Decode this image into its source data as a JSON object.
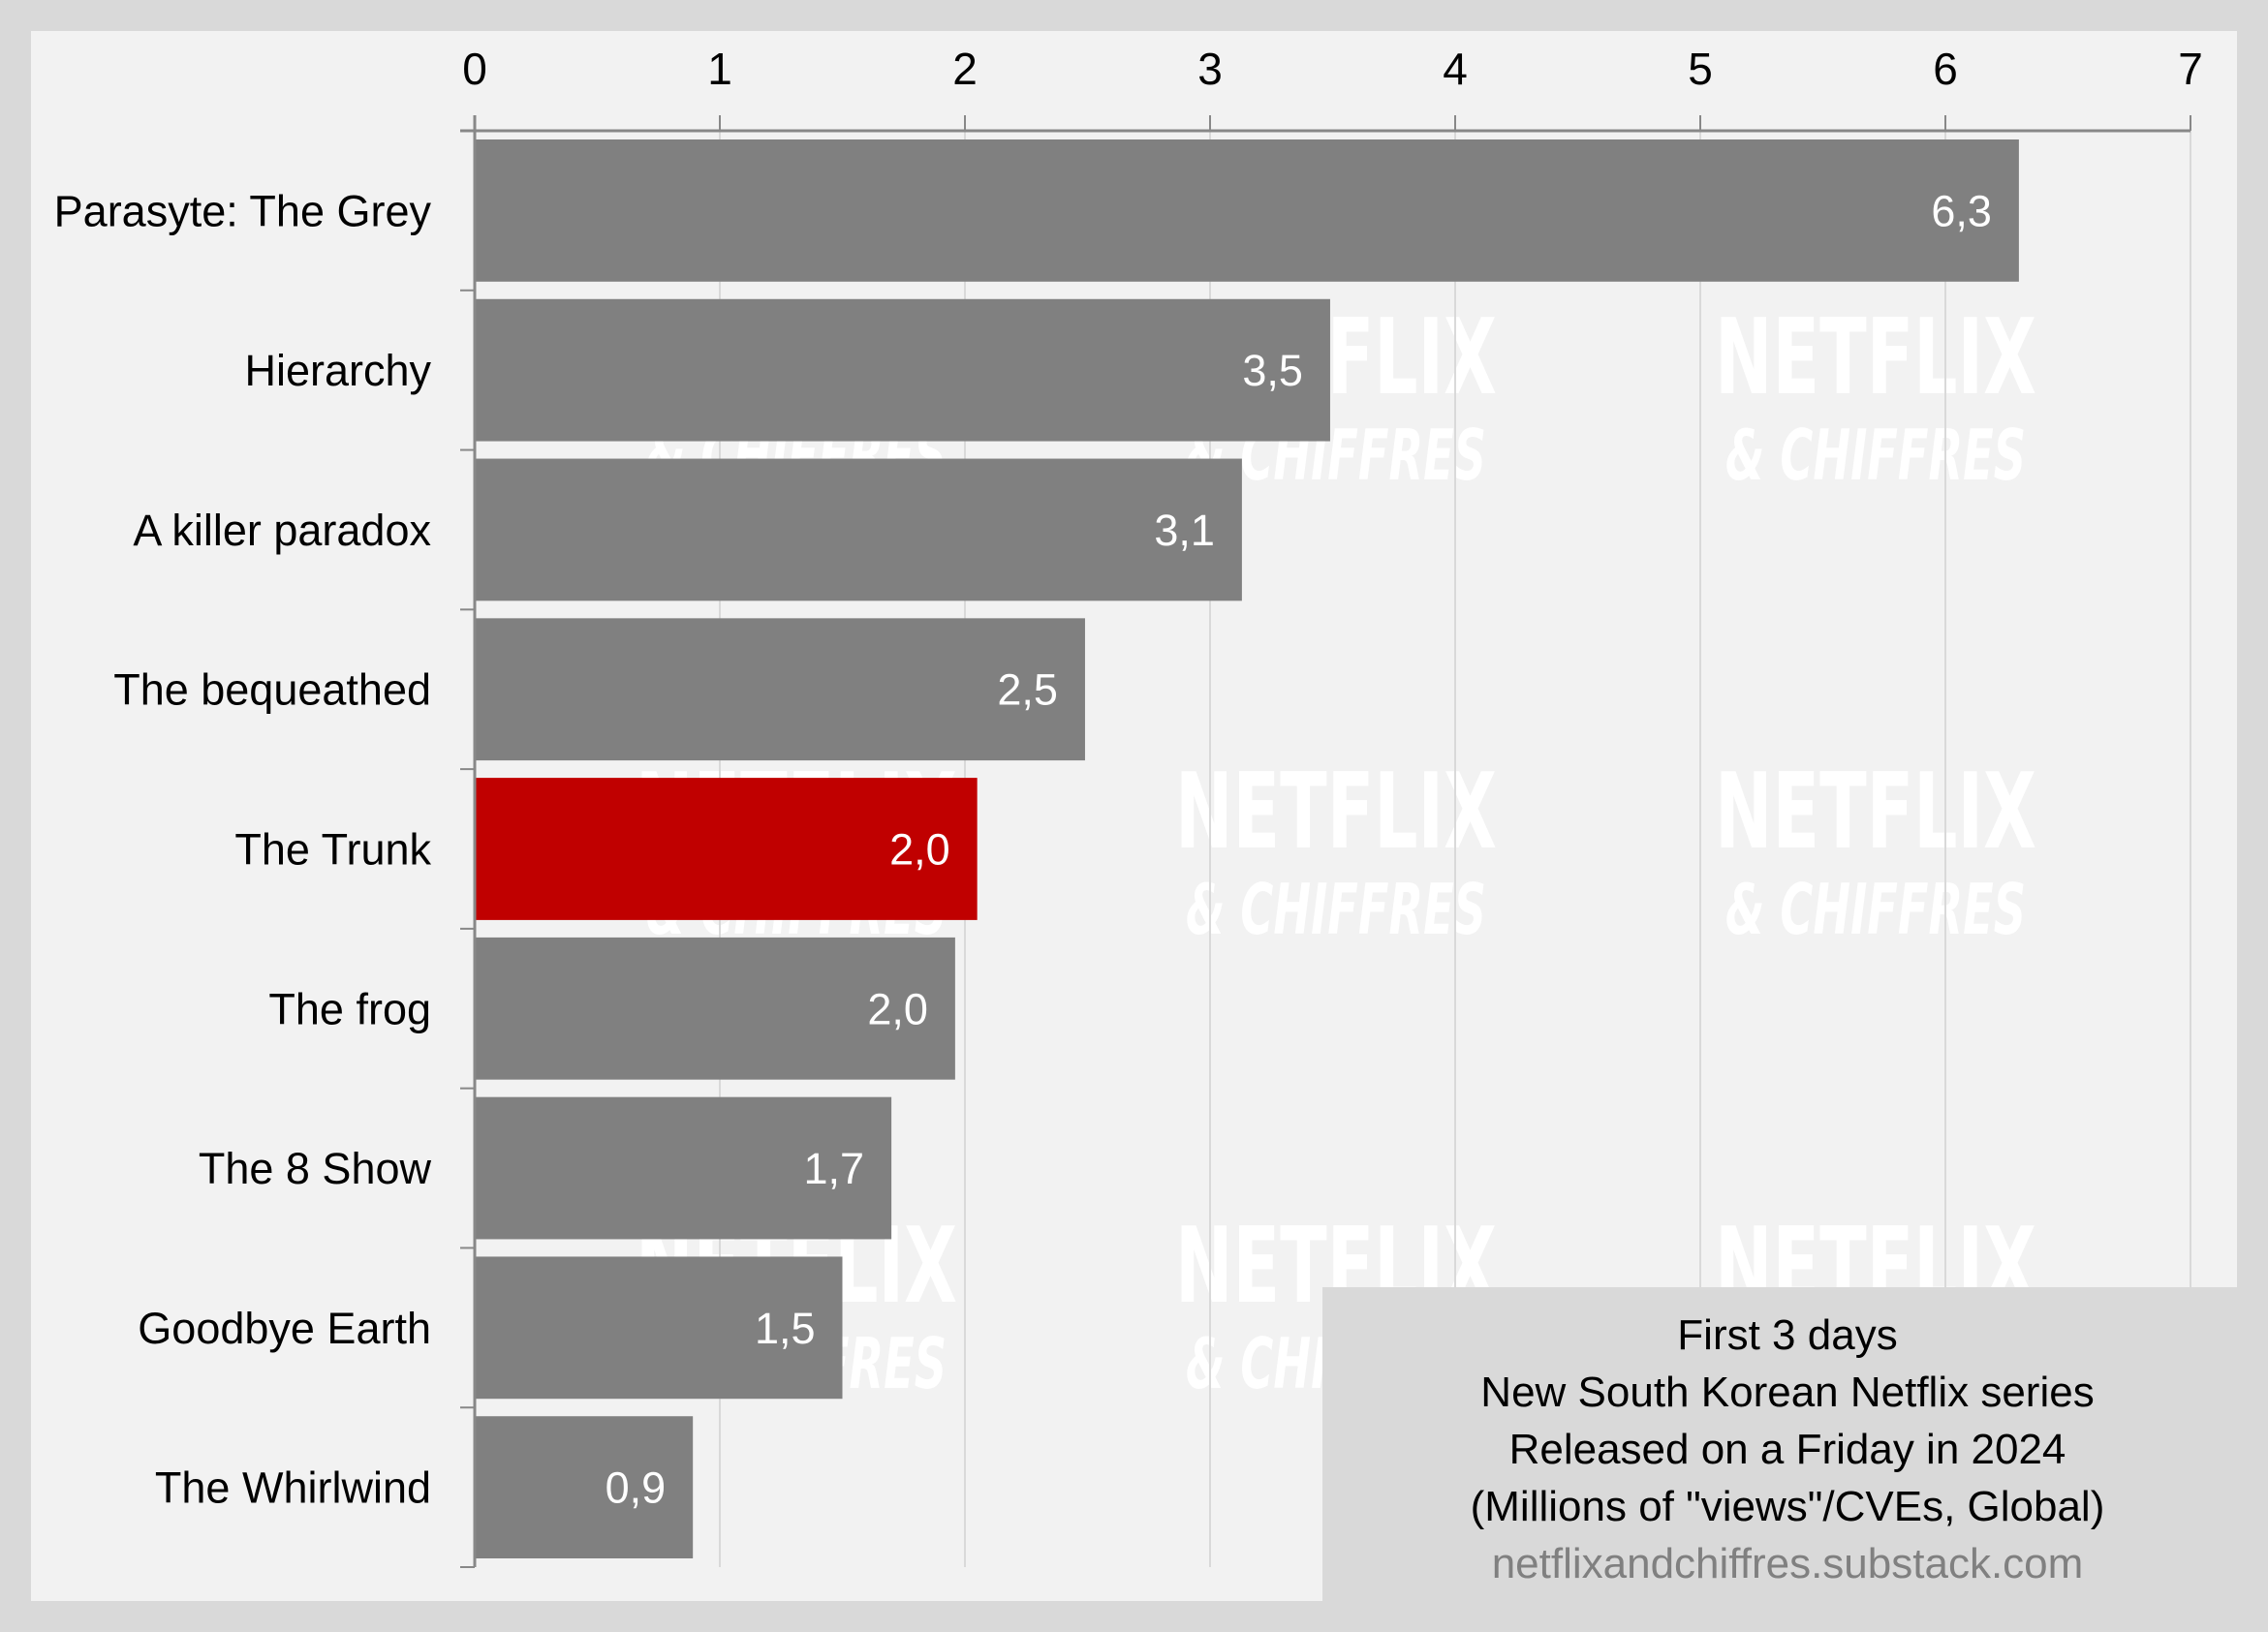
{
  "chart_data": {
    "type": "bar",
    "orientation": "horizontal",
    "categories": [
      "Parasyte: The Grey",
      "Hierarchy",
      "A killer paradox",
      "The bequeathed",
      "The Trunk",
      "The frog",
      "The 8 Show",
      "Goodbye Earth",
      "The Whirlwind"
    ],
    "values": [
      6.3,
      3.49,
      3.13,
      2.49,
      2.05,
      1.96,
      1.7,
      1.5,
      0.89
    ],
    "value_labels": [
      "6,3",
      "3,5",
      "3,1",
      "2,5",
      "2,0",
      "2,0",
      "1,7",
      "1,5",
      "0,9"
    ],
    "highlight_index": 4,
    "colors": {
      "default": "#808080",
      "highlight": "#c00000",
      "background": "#f2f2f2",
      "frame": "#d9d9d9",
      "grid": "#d9d9d9",
      "axis": "#888888"
    },
    "xlim": [
      0,
      7
    ],
    "xticks": [
      0,
      1,
      2,
      3,
      4,
      5,
      6,
      7
    ],
    "xtick_labels": [
      "0",
      "1",
      "2",
      "3",
      "4",
      "5",
      "6",
      "7"
    ],
    "x_axis_position": "top",
    "grid": true,
    "title": "",
    "xlabel": "",
    "ylabel": "",
    "annotation": {
      "lines": [
        "First 3 days",
        "New South Korean Netflix series",
        "Released on a Friday in 2024",
        "(Millions of \"views\"/CVEs, Global)"
      ],
      "source": "netflixandchiffres.substack.com",
      "placement": "bottom-right"
    },
    "watermark": {
      "title": "NETFLIX",
      "subtitle": "& CHIFFRES"
    }
  }
}
